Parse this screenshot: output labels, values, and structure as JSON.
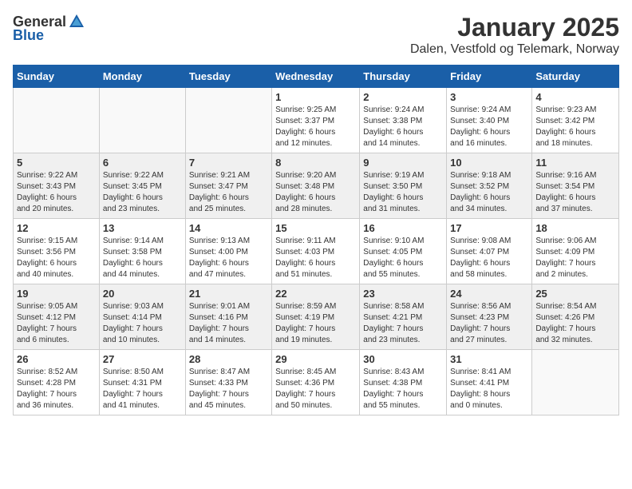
{
  "header": {
    "logo_general": "General",
    "logo_blue": "Blue",
    "month_title": "January 2025",
    "location": "Dalen, Vestfold og Telemark, Norway"
  },
  "weekdays": [
    "Sunday",
    "Monday",
    "Tuesday",
    "Wednesday",
    "Thursday",
    "Friday",
    "Saturday"
  ],
  "weeks": [
    [
      {
        "day": "",
        "info": ""
      },
      {
        "day": "",
        "info": ""
      },
      {
        "day": "",
        "info": ""
      },
      {
        "day": "1",
        "info": "Sunrise: 9:25 AM\nSunset: 3:37 PM\nDaylight: 6 hours\nand 12 minutes."
      },
      {
        "day": "2",
        "info": "Sunrise: 9:24 AM\nSunset: 3:38 PM\nDaylight: 6 hours\nand 14 minutes."
      },
      {
        "day": "3",
        "info": "Sunrise: 9:24 AM\nSunset: 3:40 PM\nDaylight: 6 hours\nand 16 minutes."
      },
      {
        "day": "4",
        "info": "Sunrise: 9:23 AM\nSunset: 3:42 PM\nDaylight: 6 hours\nand 18 minutes."
      }
    ],
    [
      {
        "day": "5",
        "info": "Sunrise: 9:22 AM\nSunset: 3:43 PM\nDaylight: 6 hours\nand 20 minutes."
      },
      {
        "day": "6",
        "info": "Sunrise: 9:22 AM\nSunset: 3:45 PM\nDaylight: 6 hours\nand 23 minutes."
      },
      {
        "day": "7",
        "info": "Sunrise: 9:21 AM\nSunset: 3:47 PM\nDaylight: 6 hours\nand 25 minutes."
      },
      {
        "day": "8",
        "info": "Sunrise: 9:20 AM\nSunset: 3:48 PM\nDaylight: 6 hours\nand 28 minutes."
      },
      {
        "day": "9",
        "info": "Sunrise: 9:19 AM\nSunset: 3:50 PM\nDaylight: 6 hours\nand 31 minutes."
      },
      {
        "day": "10",
        "info": "Sunrise: 9:18 AM\nSunset: 3:52 PM\nDaylight: 6 hours\nand 34 minutes."
      },
      {
        "day": "11",
        "info": "Sunrise: 9:16 AM\nSunset: 3:54 PM\nDaylight: 6 hours\nand 37 minutes."
      }
    ],
    [
      {
        "day": "12",
        "info": "Sunrise: 9:15 AM\nSunset: 3:56 PM\nDaylight: 6 hours\nand 40 minutes."
      },
      {
        "day": "13",
        "info": "Sunrise: 9:14 AM\nSunset: 3:58 PM\nDaylight: 6 hours\nand 44 minutes."
      },
      {
        "day": "14",
        "info": "Sunrise: 9:13 AM\nSunset: 4:00 PM\nDaylight: 6 hours\nand 47 minutes."
      },
      {
        "day": "15",
        "info": "Sunrise: 9:11 AM\nSunset: 4:03 PM\nDaylight: 6 hours\nand 51 minutes."
      },
      {
        "day": "16",
        "info": "Sunrise: 9:10 AM\nSunset: 4:05 PM\nDaylight: 6 hours\nand 55 minutes."
      },
      {
        "day": "17",
        "info": "Sunrise: 9:08 AM\nSunset: 4:07 PM\nDaylight: 6 hours\nand 58 minutes."
      },
      {
        "day": "18",
        "info": "Sunrise: 9:06 AM\nSunset: 4:09 PM\nDaylight: 7 hours\nand 2 minutes."
      }
    ],
    [
      {
        "day": "19",
        "info": "Sunrise: 9:05 AM\nSunset: 4:12 PM\nDaylight: 7 hours\nand 6 minutes."
      },
      {
        "day": "20",
        "info": "Sunrise: 9:03 AM\nSunset: 4:14 PM\nDaylight: 7 hours\nand 10 minutes."
      },
      {
        "day": "21",
        "info": "Sunrise: 9:01 AM\nSunset: 4:16 PM\nDaylight: 7 hours\nand 14 minutes."
      },
      {
        "day": "22",
        "info": "Sunrise: 8:59 AM\nSunset: 4:19 PM\nDaylight: 7 hours\nand 19 minutes."
      },
      {
        "day": "23",
        "info": "Sunrise: 8:58 AM\nSunset: 4:21 PM\nDaylight: 7 hours\nand 23 minutes."
      },
      {
        "day": "24",
        "info": "Sunrise: 8:56 AM\nSunset: 4:23 PM\nDaylight: 7 hours\nand 27 minutes."
      },
      {
        "day": "25",
        "info": "Sunrise: 8:54 AM\nSunset: 4:26 PM\nDaylight: 7 hours\nand 32 minutes."
      }
    ],
    [
      {
        "day": "26",
        "info": "Sunrise: 8:52 AM\nSunset: 4:28 PM\nDaylight: 7 hours\nand 36 minutes."
      },
      {
        "day": "27",
        "info": "Sunrise: 8:50 AM\nSunset: 4:31 PM\nDaylight: 7 hours\nand 41 minutes."
      },
      {
        "day": "28",
        "info": "Sunrise: 8:47 AM\nSunset: 4:33 PM\nDaylight: 7 hours\nand 45 minutes."
      },
      {
        "day": "29",
        "info": "Sunrise: 8:45 AM\nSunset: 4:36 PM\nDaylight: 7 hours\nand 50 minutes."
      },
      {
        "day": "30",
        "info": "Sunrise: 8:43 AM\nSunset: 4:38 PM\nDaylight: 7 hours\nand 55 minutes."
      },
      {
        "day": "31",
        "info": "Sunrise: 8:41 AM\nSunset: 4:41 PM\nDaylight: 8 hours\nand 0 minutes."
      },
      {
        "day": "",
        "info": ""
      }
    ]
  ]
}
